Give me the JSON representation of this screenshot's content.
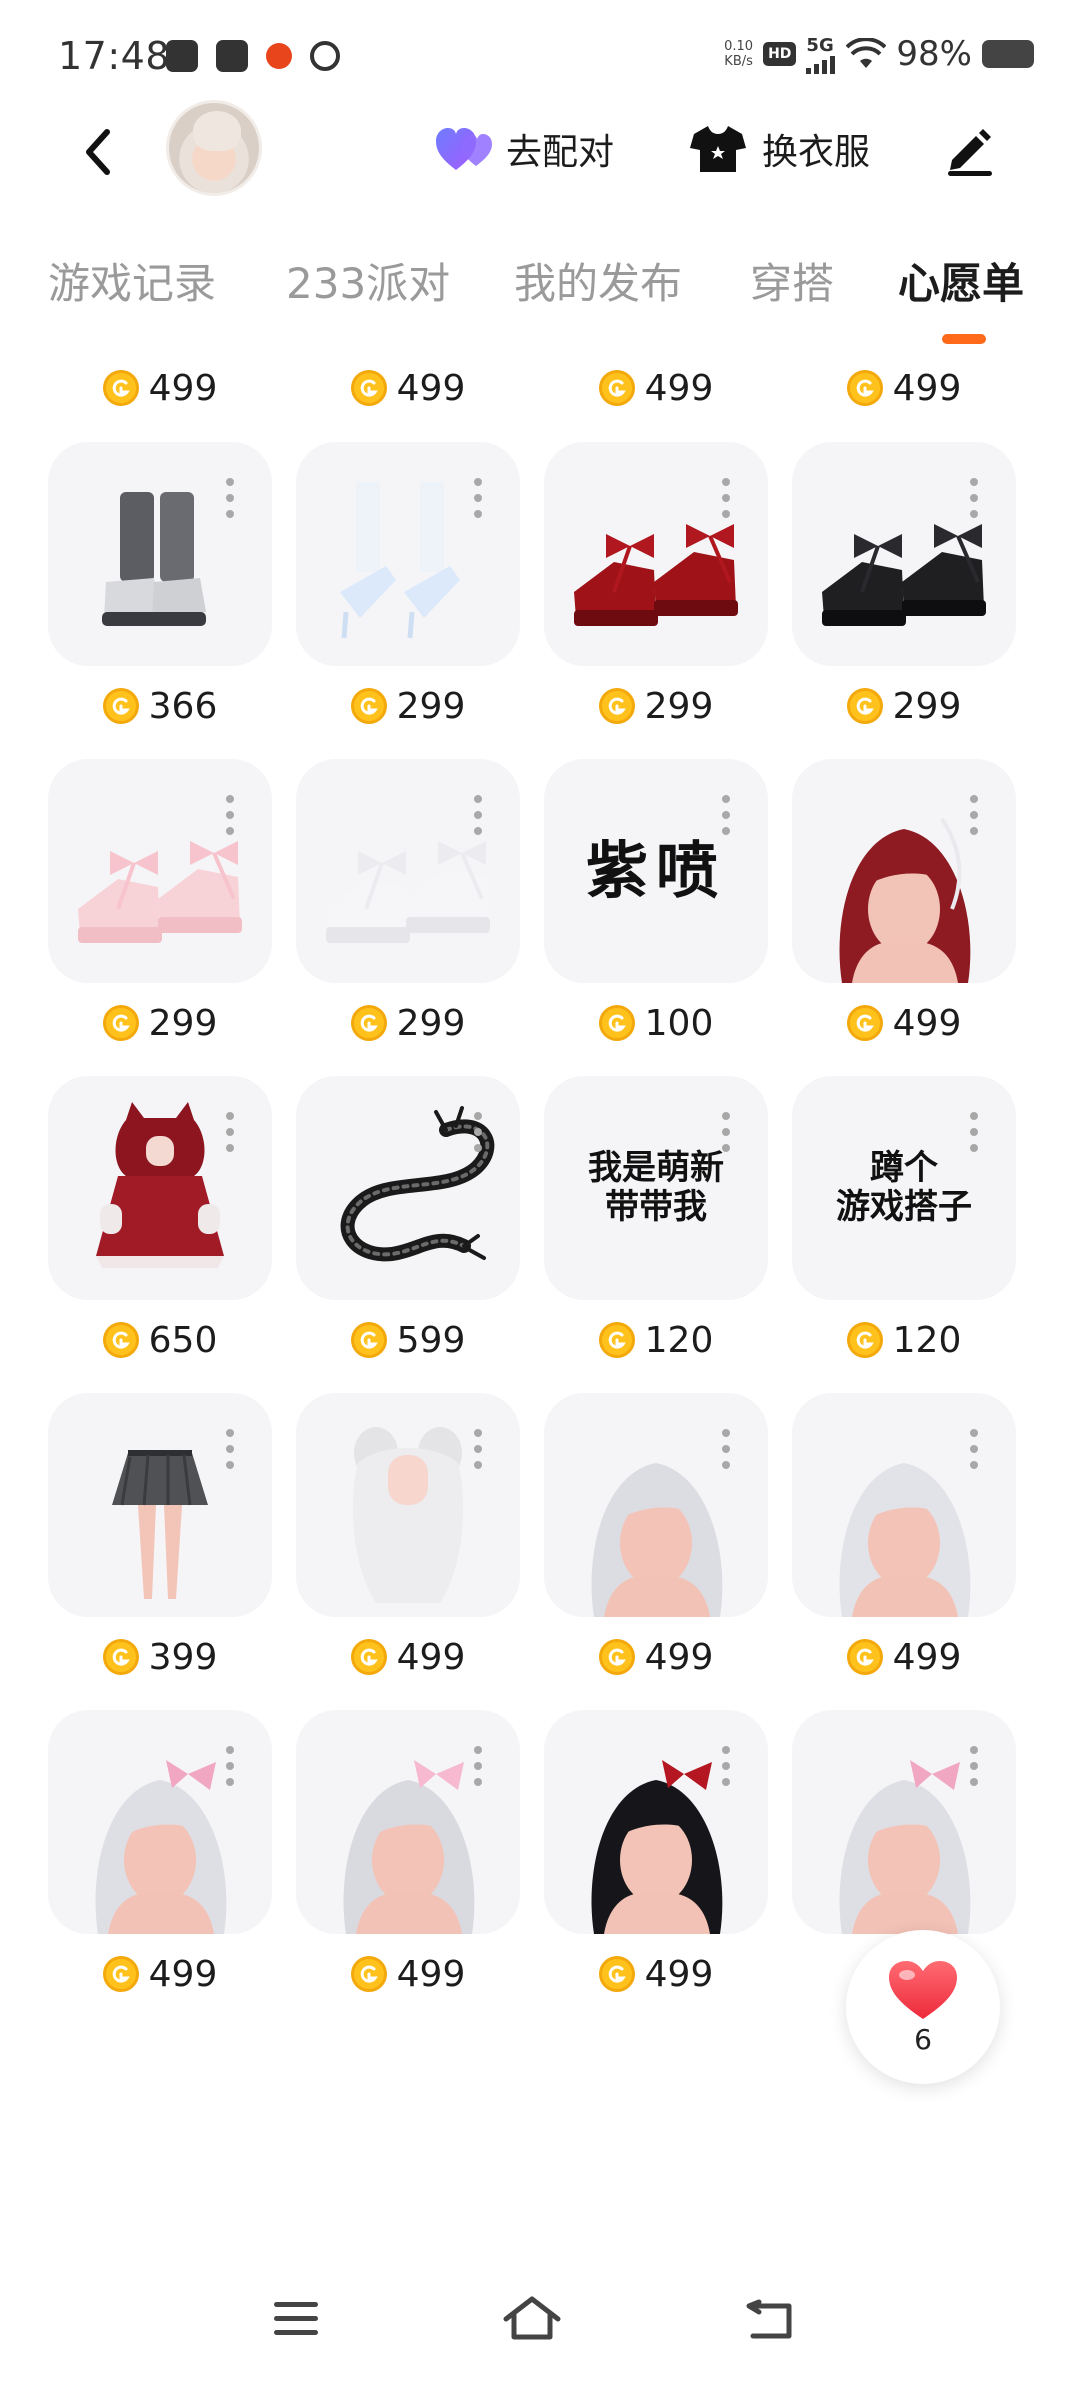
{
  "status_bar": {
    "time": "17:48",
    "net_speed_value": "0.10",
    "net_speed_unit": "KB/s",
    "hd_label": "HD",
    "network_label": "5G",
    "battery_percent": "98%",
    "left_icons": [
      "scissors-app-icon",
      "mail-app-icon",
      "basketball-app-icon",
      "orbit-app-icon"
    ]
  },
  "header": {
    "match_label": "去配对",
    "outfit_label": "换衣服",
    "colors": {
      "heart_gradient_start": "#6f7cff",
      "heart_gradient_end": "#a25cff"
    }
  },
  "tabs": [
    {
      "label": "游戏记录",
      "active": false
    },
    {
      "label": "233派对",
      "active": false
    },
    {
      "label": "我的发布",
      "active": false
    },
    {
      "label": "穿搭",
      "active": false
    },
    {
      "label": "心愿单",
      "active": true
    }
  ],
  "accent_color": "#ff6a1a",
  "coin_color": "#ffc21c",
  "wishlist": {
    "partial_row_prices": [
      "499",
      "499",
      "499",
      "499"
    ],
    "items": [
      {
        "price": "366",
        "art": "grey-boots"
      },
      {
        "price": "299",
        "art": "white-heels"
      },
      {
        "price": "299",
        "art": "red-platform-shoes"
      },
      {
        "price": "299",
        "art": "black-platform-shoes"
      },
      {
        "price": "299",
        "art": "pink-platform-shoes"
      },
      {
        "price": "299",
        "art": "white-platform-shoes"
      },
      {
        "price": "100",
        "art": "text",
        "text_lines": [
          "紫喷"
        ]
      },
      {
        "price": "499",
        "art": "red-long-hair"
      },
      {
        "price": "650",
        "art": "red-hood-dress"
      },
      {
        "price": "599",
        "art": "black-dragon"
      },
      {
        "price": "120",
        "art": "text",
        "text_lines": [
          "我是萌新",
          "带带我"
        ]
      },
      {
        "price": "120",
        "art": "text",
        "text_lines": [
          "蹲个",
          "游戏搭子"
        ]
      },
      {
        "price": "399",
        "art": "grey-skirt"
      },
      {
        "price": "499",
        "art": "white-twin-hair"
      },
      {
        "price": "499",
        "art": "silver-hair-a"
      },
      {
        "price": "499",
        "art": "silver-hair-b"
      },
      {
        "price": "499",
        "art": "silver-hair-pink-bow"
      },
      {
        "price": "499",
        "art": "silver-hair-c"
      },
      {
        "price": "499",
        "art": "black-hair-red-bows"
      },
      {
        "price": "",
        "art": "silver-hair-pink-ears"
      }
    ]
  },
  "favorite": {
    "count": "6"
  }
}
